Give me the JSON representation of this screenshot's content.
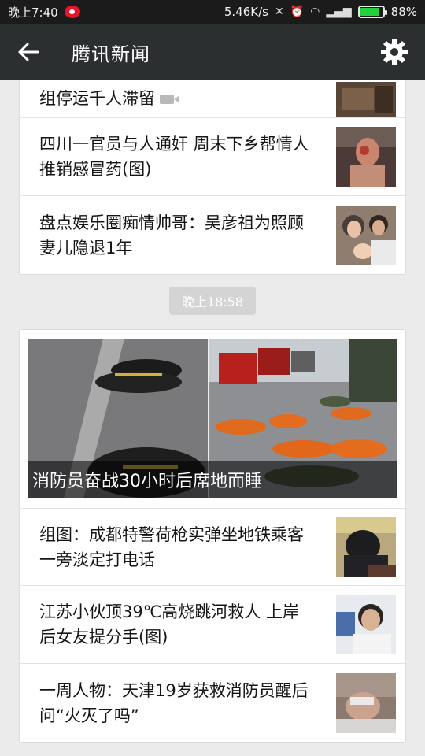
{
  "status_bar": {
    "time": "晚上7:40",
    "network_speed": "5.46K/s",
    "battery": "88%",
    "battery_level": 0.88
  },
  "header": {
    "title": "腾讯新闻"
  },
  "feed": {
    "top_card": [
      {
        "title": "组停运千人滞留",
        "has_video": true
      },
      {
        "title": "四川一官员与人通奸 周末下乡帮情人推销感冒药(图)"
      },
      {
        "title": "盘点娱乐圈痴情帅哥：吴彦祖为照顾妻儿隐退1年"
      }
    ],
    "timestamp": "晚上18:58",
    "bottom_card": {
      "hero_caption": "消防员奋战30小时后席地而睡",
      "items": [
        {
          "title": "组图：成都特警荷枪实弹坐地铁乘客一旁淡定打电话"
        },
        {
          "title": "江苏小伙顶39℃高烧跳河救人 上岸后女友提分手(图)"
        },
        {
          "title": "一周人物：天津19岁获救消防员醒后问“火灭了吗”"
        }
      ]
    }
  }
}
